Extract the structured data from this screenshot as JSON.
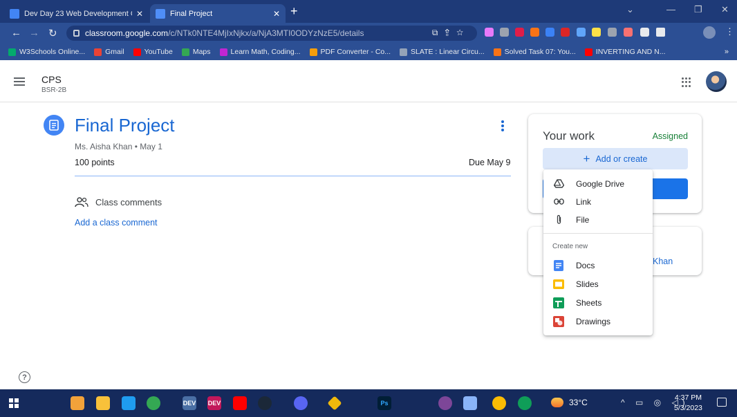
{
  "browser": {
    "tabs": [
      {
        "title": "Dev Day 23 Web Development C",
        "favicon_color": "#4285f4",
        "active": false
      },
      {
        "title": "Final Project",
        "favicon_color": "#4f8ef7",
        "active": true
      }
    ],
    "tab_close_glyph": "✕",
    "new_tab_glyph": "+",
    "url_domain": "classroom.google.com",
    "url_path": "/c/NTk0NTE4MjIxNjkx/a/NjA3MTI0ODYzNzE5/details",
    "bookmarks": [
      {
        "label": "W3Schools Online...",
        "color": "#04aa6d"
      },
      {
        "label": "Gmail",
        "color": "#ea4335"
      },
      {
        "label": "YouTube",
        "color": "#ff0000"
      },
      {
        "label": "Maps",
        "color": "#34a853"
      },
      {
        "label": "Learn Math, Coding...",
        "color": "#c026d3"
      },
      {
        "label": "PDF Converter - Co...",
        "color": "#f59e0b"
      },
      {
        "label": "SLATE : Linear Circu...",
        "color": "#94a3b8"
      },
      {
        "label": "Solved Task 07: You...",
        "color": "#f97316"
      },
      {
        "label": "INVERTING AND N...",
        "color": "#ff0000"
      }
    ],
    "bookmarks_more": "»"
  },
  "classroom": {
    "class_name": "CPS",
    "class_section": "BSR-2B",
    "assignment": {
      "title": "Final Project",
      "meta": "Ms. Aisha Khan • May 1",
      "points": "100 points",
      "due": "Due May 9",
      "comments_label": "Class comments",
      "add_comment": "Add a class comment"
    },
    "your_work": {
      "title": "Your work",
      "status": "Assigned",
      "add_create": "Add or create",
      "add_plus": "+"
    },
    "teacher_fragment": "Khan",
    "menu": {
      "attach_items": [
        {
          "label": "Google Drive",
          "icon": "drive-icon"
        },
        {
          "label": "Link",
          "icon": "link-icon"
        },
        {
          "label": "File",
          "icon": "paperclip-icon"
        }
      ],
      "create_heading": "Create new",
      "create_items": [
        {
          "label": "Docs",
          "icon": "docs-icon",
          "color": "#4285f4"
        },
        {
          "label": "Slides",
          "icon": "slides-icon",
          "color": "#fbbc04"
        },
        {
          "label": "Sheets",
          "icon": "sheets-icon",
          "color": "#0f9d58"
        },
        {
          "label": "Drawings",
          "icon": "drawings-icon",
          "color": "#db4437"
        }
      ]
    },
    "help_glyph": "?"
  },
  "taskbar": {
    "apps": [
      {
        "name": "windows-start-icon",
        "color": "#ffffff"
      },
      {
        "name": "app-icon",
        "color": "#f2a23a"
      },
      {
        "name": "file-explorer-icon",
        "color": "#f8c13a"
      },
      {
        "name": "vscode-icon",
        "color": "#1f9cf0"
      },
      {
        "name": "chrome-icon",
        "color": "#34a853"
      },
      {
        "name": "devcpp-icon",
        "color": "#4a6fa5",
        "label": "DEV"
      },
      {
        "name": "devcpp-alt-icon",
        "color": "#c2185b",
        "label": "DEV"
      },
      {
        "name": "youtube-icon",
        "color": "#ff0000"
      },
      {
        "name": "steam-icon",
        "color": "#1b2838"
      },
      {
        "name": "discord-icon",
        "color": "#5865f2"
      },
      {
        "name": "binance-icon",
        "color": "#f0b90b"
      },
      {
        "name": "photoshop-icon",
        "color": "#31a8ff",
        "label": "Ps"
      },
      {
        "name": "tor-icon",
        "color": "#7d4698"
      },
      {
        "name": "app-icon",
        "color": "#8ab4f8"
      },
      {
        "name": "chrome-icon",
        "color": "#fbbc04"
      },
      {
        "name": "chrome-canary-icon",
        "color": "#0f9d58"
      }
    ],
    "weather": "33°C",
    "time": "4:37 PM",
    "date": "5/3/2023"
  }
}
